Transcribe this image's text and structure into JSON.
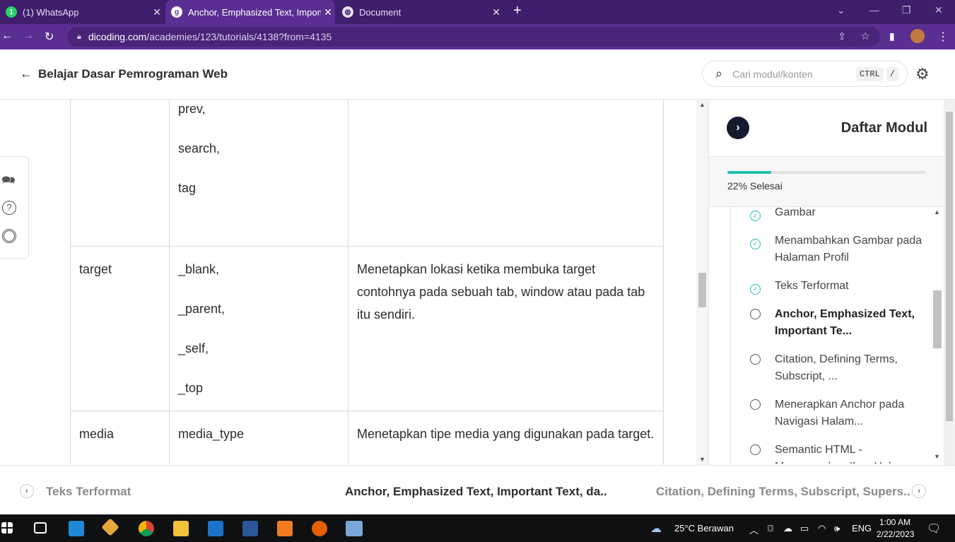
{
  "browser": {
    "tabs": [
      {
        "title": "(1) WhatsApp",
        "icon": "whatsapp-icon",
        "active": false
      },
      {
        "title": "Anchor, Emphasized Text, Important",
        "icon": "dicoding-icon",
        "active": true
      },
      {
        "title": "Document",
        "icon": "globe-icon",
        "active": false
      }
    ],
    "url_host": "dicoding.com",
    "url_path": "/academies/123/tutorials/4138?from=4135"
  },
  "header": {
    "back_label": "Belajar Dasar Pemrograman Web",
    "search_placeholder": "Cari modul/konten",
    "kbd_ctrl": "CTRL",
    "kbd_slash": "/"
  },
  "table": {
    "rows": [
      {
        "attr": "",
        "values": [
          "prev,",
          "search,",
          "tag"
        ],
        "desc": ""
      },
      {
        "attr": "target",
        "values": [
          "_blank,",
          "_parent,",
          "_self,",
          "_top"
        ],
        "desc": "Menetapkan lokasi ketika membuka target contohnya pada sebuah tab, window atau pada tab itu sendiri."
      },
      {
        "attr": "media",
        "values": [
          "media_type"
        ],
        "desc": "Menetapkan tipe media yang digunakan pada target."
      }
    ]
  },
  "sidebar": {
    "title": "Daftar Modul",
    "progress_percent": 22,
    "progress_label": "22% Selesai",
    "modules": [
      {
        "label": "Gambar",
        "done": true
      },
      {
        "label": "Menambahkan Gambar pada Halaman Profil",
        "done": true
      },
      {
        "label": "Teks Terformat",
        "done": true
      },
      {
        "label": "Anchor, Emphasized Text, Important Te...",
        "done": false,
        "current": true
      },
      {
        "label": "Citation, Defining Terms, Subscript, ...",
        "done": false
      },
      {
        "label": "Menerapkan Anchor pada Navigasi Halam...",
        "done": false
      },
      {
        "label": "Semantic HTML - Menggunakan Ikon Hal...",
        "done": false
      }
    ]
  },
  "footer": {
    "prev_label": "Teks Terformat",
    "current_label": "Anchor, Emphasized Text, Important Text, da..",
    "next_label": "Citation, Defining Terms, Subscript, Supers.."
  },
  "taskbar": {
    "weather": "25°C  Berawan",
    "lang": "ENG",
    "time": "1:00 AM",
    "date": "2/22/2023"
  },
  "colors": {
    "browser_frame": "#3e1e6d",
    "browser_active": "#5b2e92",
    "progress": "#1fc1b1",
    "check": "#1fc1b1"
  }
}
